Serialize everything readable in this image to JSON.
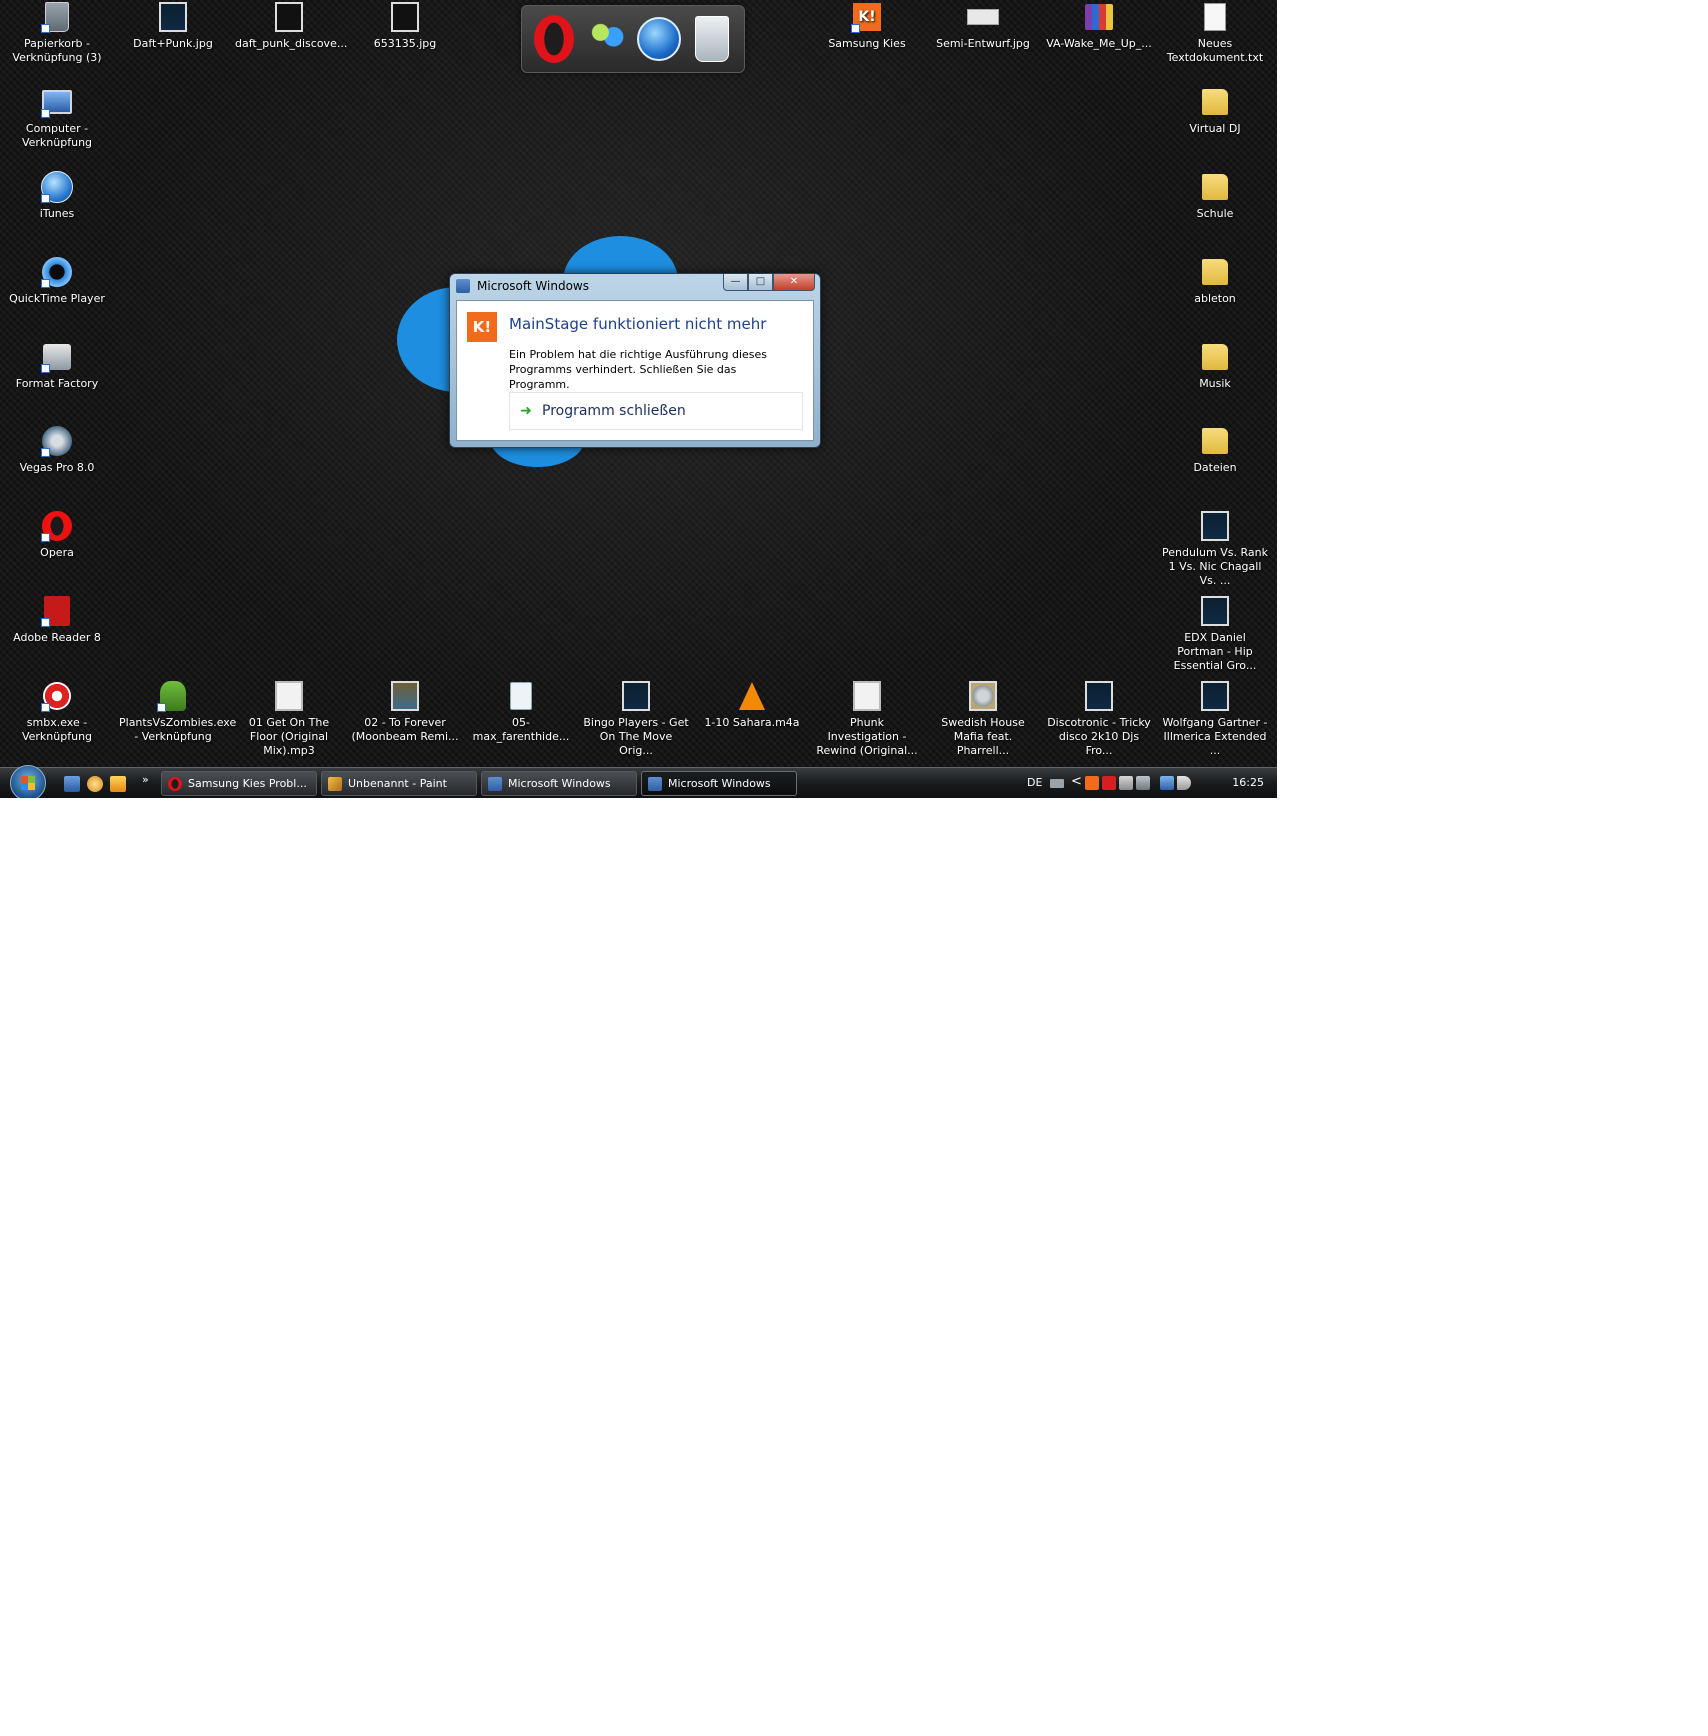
{
  "desktop": {
    "icons": [
      {
        "label": "Papierkorb - Verknüpfung (3)",
        "icon": "recycle-bin-icon"
      },
      {
        "label": "Daft+Punk.jpg",
        "icon": "image-file-icon"
      },
      {
        "label": "daft_punk_discove...",
        "icon": "image-file-icon"
      },
      {
        "label": "653135.jpg",
        "icon": "image-file-icon"
      },
      {
        "label": "Samsung Kies",
        "icon": "samsung-kies-icon"
      },
      {
        "label": "Semi-Entwurf.jpg",
        "icon": "image-file-icon"
      },
      {
        "label": "VA-Wake_Me_Up_...",
        "icon": "winrar-archive-icon"
      },
      {
        "label": "Neues Textdokument.txt",
        "icon": "text-file-icon"
      },
      {
        "label": "Computer - Verknüpfung",
        "icon": "computer-icon"
      },
      {
        "label": "iTunes",
        "icon": "itunes-icon"
      },
      {
        "label": "QuickTime Player",
        "icon": "quicktime-icon"
      },
      {
        "label": "Format Factory",
        "icon": "format-factory-icon"
      },
      {
        "label": "Vegas Pro 8.0",
        "icon": "vegas-pro-icon"
      },
      {
        "label": "Opera",
        "icon": "opera-icon"
      },
      {
        "label": "Adobe Reader 8",
        "icon": "adobe-reader-icon"
      },
      {
        "label": "Virtual DJ",
        "icon": "folder-icon"
      },
      {
        "label": "Schule",
        "icon": "folder-icon"
      },
      {
        "label": "ableton",
        "icon": "folder-icon"
      },
      {
        "label": "Musik",
        "icon": "folder-icon"
      },
      {
        "label": "Dateien",
        "icon": "folder-icon"
      },
      {
        "label": "Pendulum Vs. Rank 1 Vs. Nic Chagall Vs. ...",
        "icon": "audio-file-icon"
      },
      {
        "label": "EDX Daniel Portman - Hip Essential Gro...",
        "icon": "audio-file-icon"
      },
      {
        "label": "smbx.exe - Verknüpfung",
        "icon": "smbx-icon"
      },
      {
        "label": "PlantsVsZombies.exe - Verknüpfung",
        "icon": "plants-vs-zombies-icon"
      },
      {
        "label": "01 Get On The Floor (Original Mix).mp3",
        "icon": "audio-file-icon"
      },
      {
        "label": "02 - To Forever (Moonbeam Remi...",
        "icon": "audio-file-icon"
      },
      {
        "label": "05-max_farenthide...",
        "icon": "mp3-file-icon"
      },
      {
        "label": "Bingo Players - Get On The Move Orig...",
        "icon": "audio-file-icon"
      },
      {
        "label": "1-10 Sahara.m4a",
        "icon": "vlc-icon"
      },
      {
        "label": "Phunk Investigation - Rewind (Original...",
        "icon": "audio-file-icon"
      },
      {
        "label": "Swedish House Mafia feat. Pharrell...",
        "icon": "audio-file-icon"
      },
      {
        "label": "Discotronic - Tricky disco 2k10 Djs Fro...",
        "icon": "audio-file-icon"
      },
      {
        "label": "Wolfgang Gartner - Illmerica Extended ...",
        "icon": "audio-file-icon"
      }
    ]
  },
  "dock": {
    "items": [
      "opera-icon",
      "messenger-icon",
      "itunes-icon",
      "recycle-bin-icon"
    ]
  },
  "dialog": {
    "window_title": "Microsoft Windows",
    "heading": "MainStage funktioniert nicht mehr",
    "message": "Ein Problem hat die richtige Ausführung dieses Programms verhindert. Schließen Sie das Programm.",
    "command_label": "Programm schließen",
    "app_icon_text": "K!",
    "buttons": {
      "minimize": "—",
      "maximize": "□",
      "close": "✕"
    }
  },
  "taskbar": {
    "quick_launch_more": "»",
    "buttons": [
      {
        "label": "Samsung Kies Probl...",
        "icon": "opera-icon",
        "active": false
      },
      {
        "label": "Unbenannt - Paint",
        "icon": "paint-icon",
        "active": false
      },
      {
        "label": "Microsoft Windows",
        "icon": "windows-dialog-icon",
        "active": false
      },
      {
        "label": "Microsoft Windows",
        "icon": "windows-dialog-icon",
        "active": true
      }
    ],
    "tray": {
      "language": "DE",
      "expand": "<",
      "clock": "16:25"
    }
  },
  "colors": {
    "dialog_heading": "#1e3f8f",
    "kies_orange": "#f26a1b",
    "wallpaper_accent": "#1e8ee0"
  }
}
